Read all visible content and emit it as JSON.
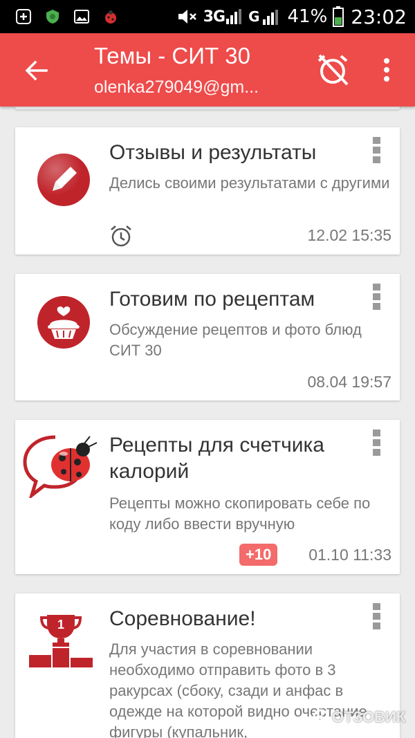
{
  "status_bar": {
    "network_label": "3G",
    "battery_percent": "41%",
    "time": "23:02"
  },
  "app_bar": {
    "title": "Темы - СИТ 30",
    "subtitle": "olenka279049@gm..."
  },
  "topics": [
    {
      "title": "Отзывы и результаты",
      "description": "Делись своими результатами с другими",
      "date": "12.02 15:35",
      "icon": "pencil-icon"
    },
    {
      "title": "Готовим по рецептам",
      "description": "Обсуждение рецептов и фото блюд СИТ 30",
      "date": "08.04 19:57",
      "icon": "cupcake-icon"
    },
    {
      "title": "Рецепты для счетчика калорий",
      "description": "Рецепты можно скопировать себе по коду либо ввести вручную",
      "badge": "+10",
      "date": "01.10 11:33",
      "icon": "ladybug-icon"
    },
    {
      "title": "Соревнование!",
      "description": "Для участия в соревновании необходимо отправить фото в 3 ракурсах (сбоку, сзади и анфас в одежде на которой видно очертание фигуры (купальник,",
      "icon": "trophy-podium-icon",
      "trophy_number": "1"
    }
  ],
  "watermark": "ОТЗОВИК",
  "colors": {
    "accent": "#ee4b4b",
    "icon_red": "#c0242b",
    "badge": "#f36b6b"
  }
}
